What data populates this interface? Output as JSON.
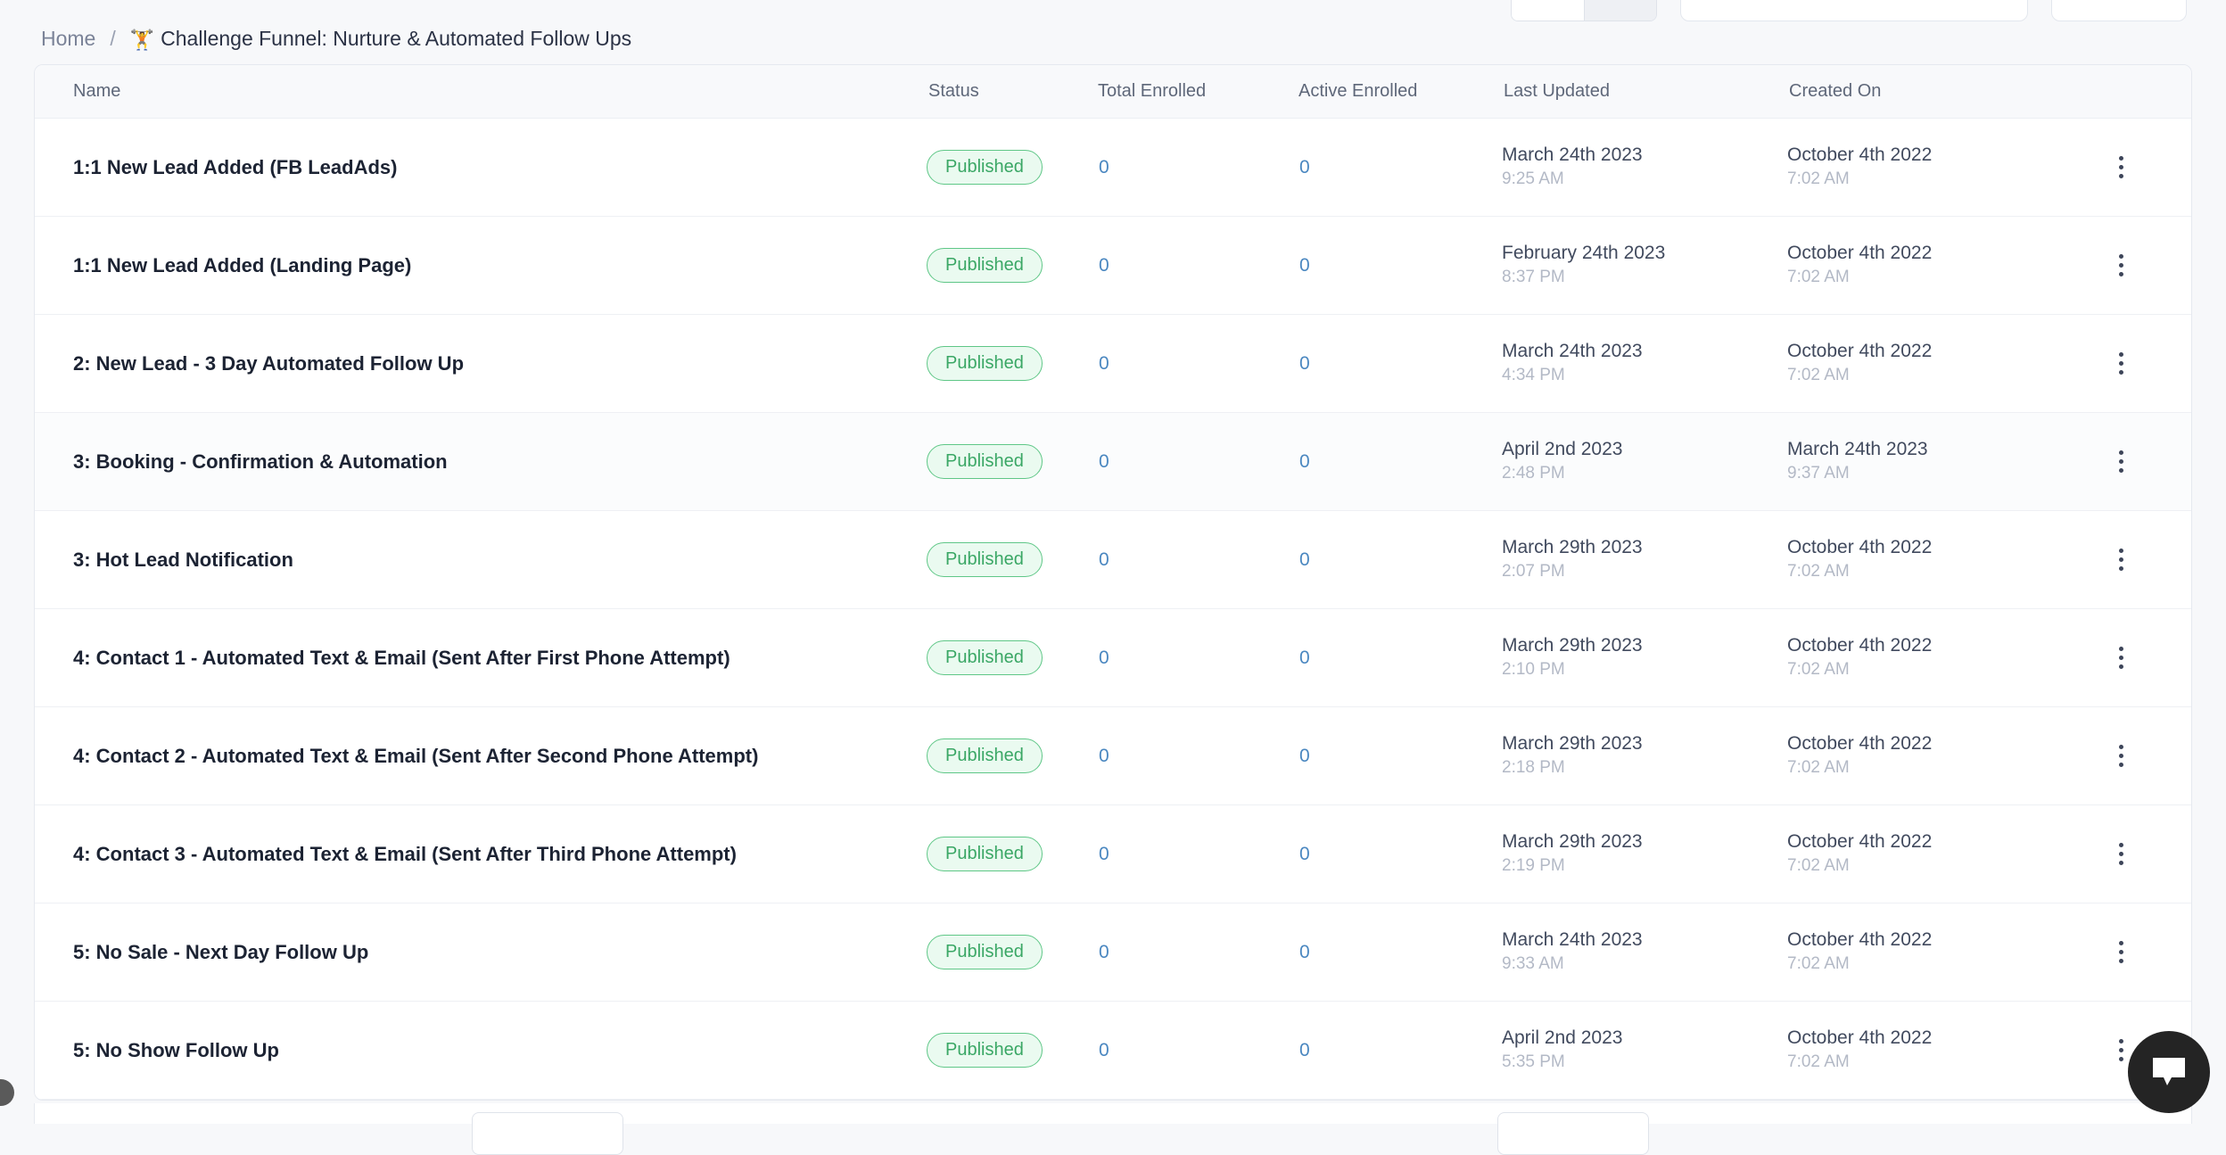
{
  "breadcrumb": {
    "home_label": "Home",
    "separator": "/",
    "emoji": "🏋️",
    "current_label": "Challenge Funnel: Nurture & Automated Follow Ups"
  },
  "table": {
    "columns": {
      "name": "Name",
      "status": "Status",
      "total_enrolled": "Total Enrolled",
      "active_enrolled": "Active Enrolled",
      "last_updated": "Last Updated",
      "created_on": "Created On"
    },
    "rows": [
      {
        "name": "1:1 New Lead Added (FB LeadAds)",
        "status": "Published",
        "total_enrolled": "0",
        "active_enrolled": "0",
        "last_updated_date": "March 24th 2023",
        "last_updated_time": "9:25 AM",
        "created_on_date": "October 4th 2022",
        "created_on_time": "7:02 AM",
        "highlighted": false
      },
      {
        "name": "1:1 New Lead Added (Landing Page)",
        "status": "Published",
        "total_enrolled": "0",
        "active_enrolled": "0",
        "last_updated_date": "February 24th 2023",
        "last_updated_time": "8:37 PM",
        "created_on_date": "October 4th 2022",
        "created_on_time": "7:02 AM",
        "highlighted": false
      },
      {
        "name": "2: New Lead - 3 Day Automated Follow Up",
        "status": "Published",
        "total_enrolled": "0",
        "active_enrolled": "0",
        "last_updated_date": "March 24th 2023",
        "last_updated_time": "4:34 PM",
        "created_on_date": "October 4th 2022",
        "created_on_time": "7:02 AM",
        "highlighted": false
      },
      {
        "name": "3: Booking - Confirmation & Automation",
        "status": "Published",
        "total_enrolled": "0",
        "active_enrolled": "0",
        "last_updated_date": "April 2nd 2023",
        "last_updated_time": "2:48 PM",
        "created_on_date": "March 24th 2023",
        "created_on_time": "9:37 AM",
        "highlighted": true
      },
      {
        "name": "3: Hot Lead Notification",
        "status": "Published",
        "total_enrolled": "0",
        "active_enrolled": "0",
        "last_updated_date": "March 29th 2023",
        "last_updated_time": "2:07 PM",
        "created_on_date": "October 4th 2022",
        "created_on_time": "7:02 AM",
        "highlighted": false
      },
      {
        "name": "4: Contact 1 - Automated Text & Email (Sent After First Phone Attempt)",
        "status": "Published",
        "total_enrolled": "0",
        "active_enrolled": "0",
        "last_updated_date": "March 29th 2023",
        "last_updated_time": "2:10 PM",
        "created_on_date": "October 4th 2022",
        "created_on_time": "7:02 AM",
        "highlighted": false
      },
      {
        "name": "4: Contact 2 - Automated Text & Email (Sent After Second Phone Attempt)",
        "status": "Published",
        "total_enrolled": "0",
        "active_enrolled": "0",
        "last_updated_date": "March 29th 2023",
        "last_updated_time": "2:18 PM",
        "created_on_date": "October 4th 2022",
        "created_on_time": "7:02 AM",
        "highlighted": false
      },
      {
        "name": "4: Contact 3 - Automated Text & Email (Sent After Third Phone Attempt)",
        "status": "Published",
        "total_enrolled": "0",
        "active_enrolled": "0",
        "last_updated_date": "March 29th 2023",
        "last_updated_time": "2:19 PM",
        "created_on_date": "October 4th 2022",
        "created_on_time": "7:02 AM",
        "highlighted": false
      },
      {
        "name": "5: No Sale - Next Day Follow Up",
        "status": "Published",
        "total_enrolled": "0",
        "active_enrolled": "0",
        "last_updated_date": "March 24th 2023",
        "last_updated_time": "9:33 AM",
        "created_on_date": "October 4th 2022",
        "created_on_time": "7:02 AM",
        "highlighted": false
      },
      {
        "name": "5: No Show Follow Up",
        "status": "Published",
        "total_enrolled": "0",
        "active_enrolled": "0",
        "last_updated_date": "April 2nd 2023",
        "last_updated_time": "5:35 PM",
        "created_on_date": "October 4th 2022",
        "created_on_time": "7:02 AM",
        "highlighted": false
      }
    ]
  },
  "icons": {
    "row_menu": "kebab-menu-icon",
    "chat": "chat-bubble-icon"
  },
  "colors": {
    "page_bg": "#f7f8fa",
    "card_bg": "#ffffff",
    "status_published_text": "#3aa765",
    "status_published_bg": "#eafaf0",
    "status_published_border": "#5fc787",
    "link_blue": "#4a87c0",
    "text_primary": "#1c2333",
    "text_muted": "#b3b9c6",
    "chat_widget_bg": "#242424"
  }
}
